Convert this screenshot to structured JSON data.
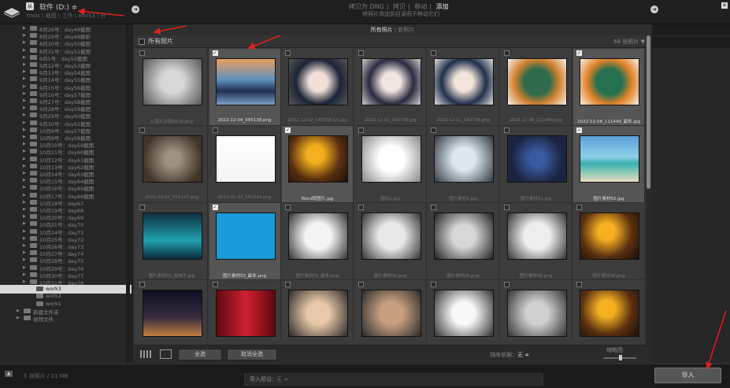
{
  "topbar": {
    "source_badge": "从",
    "source_title": "软件 (D:)",
    "source_suffix": "≑",
    "source_path": "tools \\ 截图 \\ 工作 \\ work3 \\ 分",
    "modes": [
      "拷贝为 DNG",
      "拷贝",
      "移动",
      "添加"
    ],
    "mode_active_index": 3,
    "mode_desc": "将照片添加到目录而不移动它们",
    "arrow_glyph": "➔",
    "close_glyph": "✕"
  },
  "tree": {
    "items": [
      {
        "label": "8月26号：day48截图",
        "depth": 2
      },
      {
        "label": "8月29号：day49解析",
        "depth": 2
      },
      {
        "label": "8月30号：day50截图",
        "depth": 2
      },
      {
        "label": "8月31号：day51截图",
        "depth": 2
      },
      {
        "label": "9月1号：day52截图",
        "depth": 2
      },
      {
        "label": "9月12号：day53截图",
        "depth": 2
      },
      {
        "label": "9月13号：day54截图",
        "depth": 2
      },
      {
        "label": "9月14号：day55截图",
        "depth": 2
      },
      {
        "label": "9月15号：day56截图",
        "depth": 2
      },
      {
        "label": "9月16号：day57截图",
        "depth": 2
      },
      {
        "label": "9月27号：day58截图",
        "depth": 2
      },
      {
        "label": "9月28号：day59截图",
        "depth": 2
      },
      {
        "label": "9月29号：day60截图",
        "depth": 2
      },
      {
        "label": "9月30号：day61截图",
        "depth": 2
      },
      {
        "label": "10月8号：day57截图",
        "depth": 2
      },
      {
        "label": "10月9号：day58截图",
        "depth": 2
      },
      {
        "label": "10月10号：day59截图",
        "depth": 2
      },
      {
        "label": "10月11号：day60截图",
        "depth": 2
      },
      {
        "label": "10月12号：day61截图",
        "depth": 2
      },
      {
        "label": "10月13号：day62截图",
        "depth": 2
      },
      {
        "label": "10月14号：day63截图",
        "depth": 2
      },
      {
        "label": "10月15号：day64截图",
        "depth": 2
      },
      {
        "label": "10月16号：day65截图",
        "depth": 2
      },
      {
        "label": "10月17号：day66截图",
        "depth": 2
      },
      {
        "label": "10月18号：day67",
        "depth": 2
      },
      {
        "label": "10月19号：day68",
        "depth": 2
      },
      {
        "label": "10月20号：day69",
        "depth": 2
      },
      {
        "label": "10月21号：day70",
        "depth": 2
      },
      {
        "label": "10月24号：day71",
        "depth": 2
      },
      {
        "label": "10月25号：day72",
        "depth": 2
      },
      {
        "label": "10月26号：day73",
        "depth": 2
      },
      {
        "label": "10月27号：day74",
        "depth": 2
      },
      {
        "label": "10月28号：day75",
        "depth": 2
      },
      {
        "label": "10月29号：day76",
        "depth": 2
      },
      {
        "label": "10月30号：day77",
        "depth": 2
      },
      {
        "label": "10月31号：day78",
        "depth": 2
      },
      {
        "label": "work3",
        "depth": 3,
        "selected": true
      },
      {
        "label": "work2",
        "depth": 3
      },
      {
        "label": "work1",
        "depth": 3
      },
      {
        "label": "新建文件夹",
        "depth": 1
      },
      {
        "label": "视频文件",
        "depth": 1
      }
    ]
  },
  "main": {
    "tabs": [
      "所有照片",
      "新照片"
    ],
    "tab_active_index": 0,
    "header_title": "所有照片",
    "header_sort": "68 张照片 ▼",
    "cells": [
      {
        "caption": "1-图片示例2024.png",
        "checked": false
      },
      {
        "caption": "2022-12-04_095138.png",
        "checked": true
      },
      {
        "caption": "2022-12-02_143738 (2).jpg",
        "checked": false
      },
      {
        "caption": "2022-12-02_143738.jpg",
        "checked": false
      },
      {
        "caption": "2022-12-02_143738.png",
        "checked": false
      },
      {
        "caption": "2022-12-08_111449.png",
        "checked": false
      },
      {
        "caption": "2022-12-08_111449_副本.jpg",
        "checked": true
      },
      {
        "caption": "2023-01-02_091137.png",
        "checked": false
      },
      {
        "caption": "2023-01-02_091244.png",
        "checked": false
      },
      {
        "caption": "Word转图片.jpg",
        "checked": true
      },
      {
        "caption": "图标1.jpg",
        "checked": false
      },
      {
        "caption": "图片素材1.jpg",
        "checked": false
      },
      {
        "caption": "图片素材01.jpg",
        "checked": false
      },
      {
        "caption": "图片素材02.jpg",
        "checked": true
      },
      {
        "caption": "图片素材03_海滩手.jpg",
        "checked": false
      },
      {
        "caption": "图片素材03_副本.png",
        "checked": true
      },
      {
        "caption": "图片素材05_副本.png",
        "checked": false
      },
      {
        "caption": "图片素材04.png",
        "checked": false
      },
      {
        "caption": "图片素材05.png",
        "checked": false
      },
      {
        "caption": "图片素材06.png",
        "checked": false
      },
      {
        "caption": "图片素材08.png",
        "checked": false
      },
      {
        "caption": "",
        "checked": false
      },
      {
        "caption": "",
        "checked": false
      },
      {
        "caption": "",
        "checked": false
      },
      {
        "caption": "",
        "checked": false
      },
      {
        "caption": "",
        "checked": false
      },
      {
        "caption": "",
        "checked": false
      },
      {
        "caption": "",
        "checked": false
      }
    ]
  },
  "bottombar": {
    "check_all": "全选",
    "uncheck_all": "取消全选",
    "sort_label": "排序依据：",
    "sort_value": "无 ≑",
    "thumb_label": "缩略图"
  },
  "footer": {
    "count": "5 张照片 / 11 MB",
    "preset_label": "导入预设：",
    "preset_value": "无 ≑",
    "import": "导入"
  },
  "colors": {
    "annotation": "#e02020",
    "selected_row": "#d9d9d9"
  }
}
